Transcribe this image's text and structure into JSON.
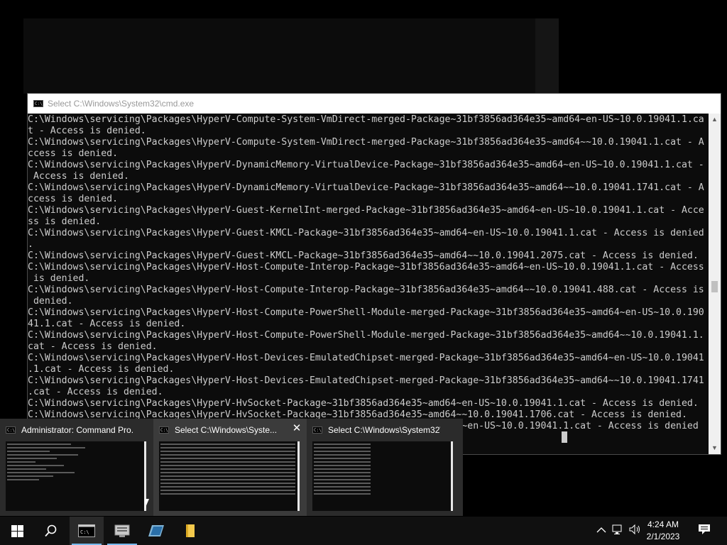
{
  "cmd_window": {
    "title": "Select C:\\Windows\\System32\\cmd.exe",
    "lines": [
      "C:\\Windows\\servicing\\Packages\\HyperV-Compute-System-VmDirect-merged-Package~31bf3856ad364e35~amd64~en-US~10.0.19041.1.ca",
      "t - Access is denied.",
      "C:\\Windows\\servicing\\Packages\\HyperV-Compute-System-VmDirect-merged-Package~31bf3856ad364e35~amd64~~10.0.19041.1.cat - A",
      "ccess is denied.",
      "C:\\Windows\\servicing\\Packages\\HyperV-DynamicMemory-VirtualDevice-Package~31bf3856ad364e35~amd64~en-US~10.0.19041.1.cat -",
      " Access is denied.",
      "C:\\Windows\\servicing\\Packages\\HyperV-DynamicMemory-VirtualDevice-Package~31bf3856ad364e35~amd64~~10.0.19041.1741.cat - A",
      "ccess is denied.",
      "C:\\Windows\\servicing\\Packages\\HyperV-Guest-KernelInt-merged-Package~31bf3856ad364e35~amd64~en-US~10.0.19041.1.cat - Acce",
      "ss is denied.",
      "C:\\Windows\\servicing\\Packages\\HyperV-Guest-KMCL-Package~31bf3856ad364e35~amd64~en-US~10.0.19041.1.cat - Access is denied",
      ".",
      "C:\\Windows\\servicing\\Packages\\HyperV-Guest-KMCL-Package~31bf3856ad364e35~amd64~~10.0.19041.2075.cat - Access is denied.",
      "C:\\Windows\\servicing\\Packages\\HyperV-Host-Compute-Interop-Package~31bf3856ad364e35~amd64~en-US~10.0.19041.1.cat - Access",
      " is denied.",
      "C:\\Windows\\servicing\\Packages\\HyperV-Host-Compute-Interop-Package~31bf3856ad364e35~amd64~~10.0.19041.488.cat - Access is",
      " denied.",
      "C:\\Windows\\servicing\\Packages\\HyperV-Host-Compute-PowerShell-Module-merged-Package~31bf3856ad364e35~amd64~en-US~10.0.190",
      "41.1.cat - Access is denied.",
      "C:\\Windows\\servicing\\Packages\\HyperV-Host-Compute-PowerShell-Module-merged-Package~31bf3856ad364e35~amd64~~10.0.19041.1.",
      "cat - Access is denied.",
      "C:\\Windows\\servicing\\Packages\\HyperV-Host-Devices-EmulatedChipset-merged-Package~31bf3856ad364e35~amd64~en-US~10.0.19041",
      ".1.cat - Access is denied.",
      "C:\\Windows\\servicing\\Packages\\HyperV-Host-Devices-EmulatedChipset-merged-Package~31bf3856ad364e35~amd64~~10.0.19041.1741",
      ".cat - Access is denied.",
      "C:\\Windows\\servicing\\Packages\\HyperV-HvSocket-Package~31bf3856ad364e35~amd64~en-US~10.0.19041.1.cat - Access is denied.",
      "C:\\Windows\\servicing\\Packages\\HyperV-HvSocket-Package~31bf3856ad364e35~amd64~~10.0.19041.1706.cat - Access is denied.",
      "C:\\Windows\\servicing\\Packages\\HyperV-HypervisorPackage~31bf3856ad364e35~amd64~en-US~10.0.19041.1.cat - Access is denied"
    ]
  },
  "thumbnails": [
    {
      "title": "Administrator:  Command Pro..."
    },
    {
      "title": "Select C:\\Windows\\Syste...",
      "close": "✕"
    },
    {
      "title": "Select C:\\Windows\\System32\\c..."
    }
  ],
  "clock": {
    "time": "4:24 AM",
    "date": "2/1/2023"
  },
  "taskbar_icons": [
    "windows-start-icon",
    "search-icon",
    "cmd-icon",
    "server-manager-icon",
    "powershell-icon",
    "file-explorer-icon"
  ],
  "tray_icons": [
    "chevron-up-icon",
    "network-icon",
    "volume-icon",
    "notification-icon"
  ]
}
